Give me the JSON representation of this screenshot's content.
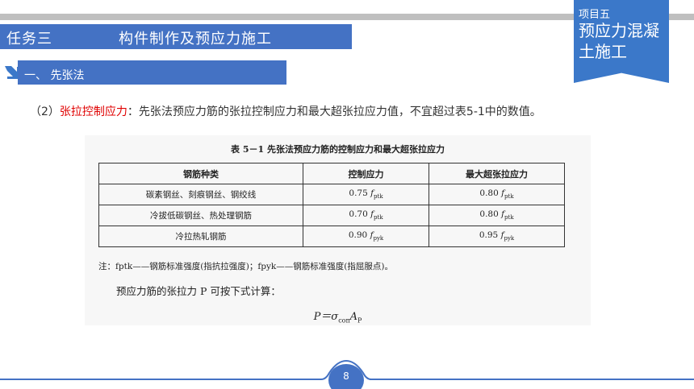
{
  "header": {
    "task_label": "任务三",
    "topic": "构件制作及预应力施工",
    "project_label": "项目五",
    "project_name": "预应力混凝土施工"
  },
  "section": {
    "title": "一、 先张法"
  },
  "paragraph": {
    "prefix": "（2）",
    "highlight": "张拉控制应力",
    "text": "：先张法预应力筋的张拉控制应力和最大超张拉应力值，不宜超过表5-1中的数值。"
  },
  "scan": {
    "caption": "表 5－1   先张法预应力筋的控制应力和最大超张拉应力",
    "columns": [
      "钢筋种类",
      "控制应力",
      "最大超张拉应力"
    ],
    "rows": [
      [
        "碳素钢丝、刻痕钢丝、钢绞线",
        "0.75",
        "ptk",
        "0.80",
        "ptk"
      ],
      [
        "冷拔低碳钢丝、热处理钢筋",
        "0.70",
        "ptk",
        "0.80",
        "ptk"
      ],
      [
        "冷拉热轧钢筋",
        "0.90",
        "pyk",
        "0.95",
        "pyk"
      ]
    ],
    "note": "注：fptk——钢筋标准强度(指抗拉强度)；fpyk——钢筋标准强度(指屈服点)。",
    "calc_text": "预应力筋的张拉力 P 可按下式计算：",
    "formula_lhs": "P＝σ",
    "formula_sub": "con",
    "formula_rhs": "A",
    "formula_rhs_sub": "P"
  },
  "footer": {
    "page": "8"
  },
  "colors": {
    "accent": "#4472c4",
    "ribbon": "#3b78c9",
    "highlight": "#e00000"
  }
}
